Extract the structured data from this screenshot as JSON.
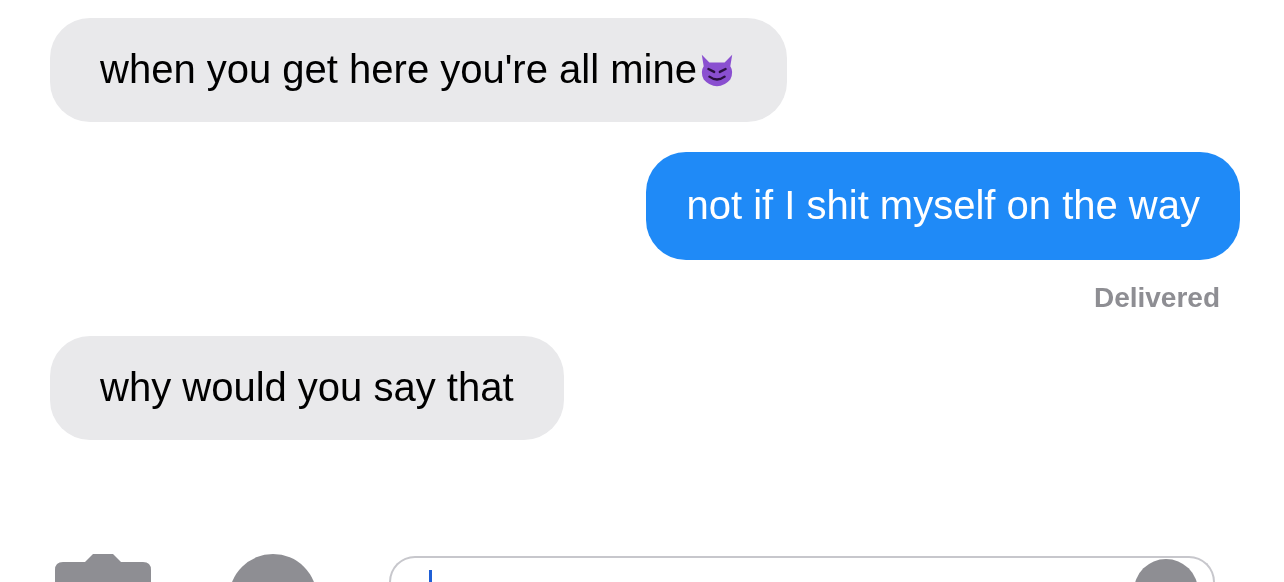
{
  "messages": [
    {
      "kind": "received",
      "text": "when you get here you're all mine",
      "has_emoji": true
    },
    {
      "kind": "sent",
      "text": "not if I shit myself on the way",
      "has_emoji": false
    },
    {
      "kind": "status",
      "text": "Delivered"
    },
    {
      "kind": "received",
      "text": "why would you say that",
      "has_emoji": false
    }
  ]
}
